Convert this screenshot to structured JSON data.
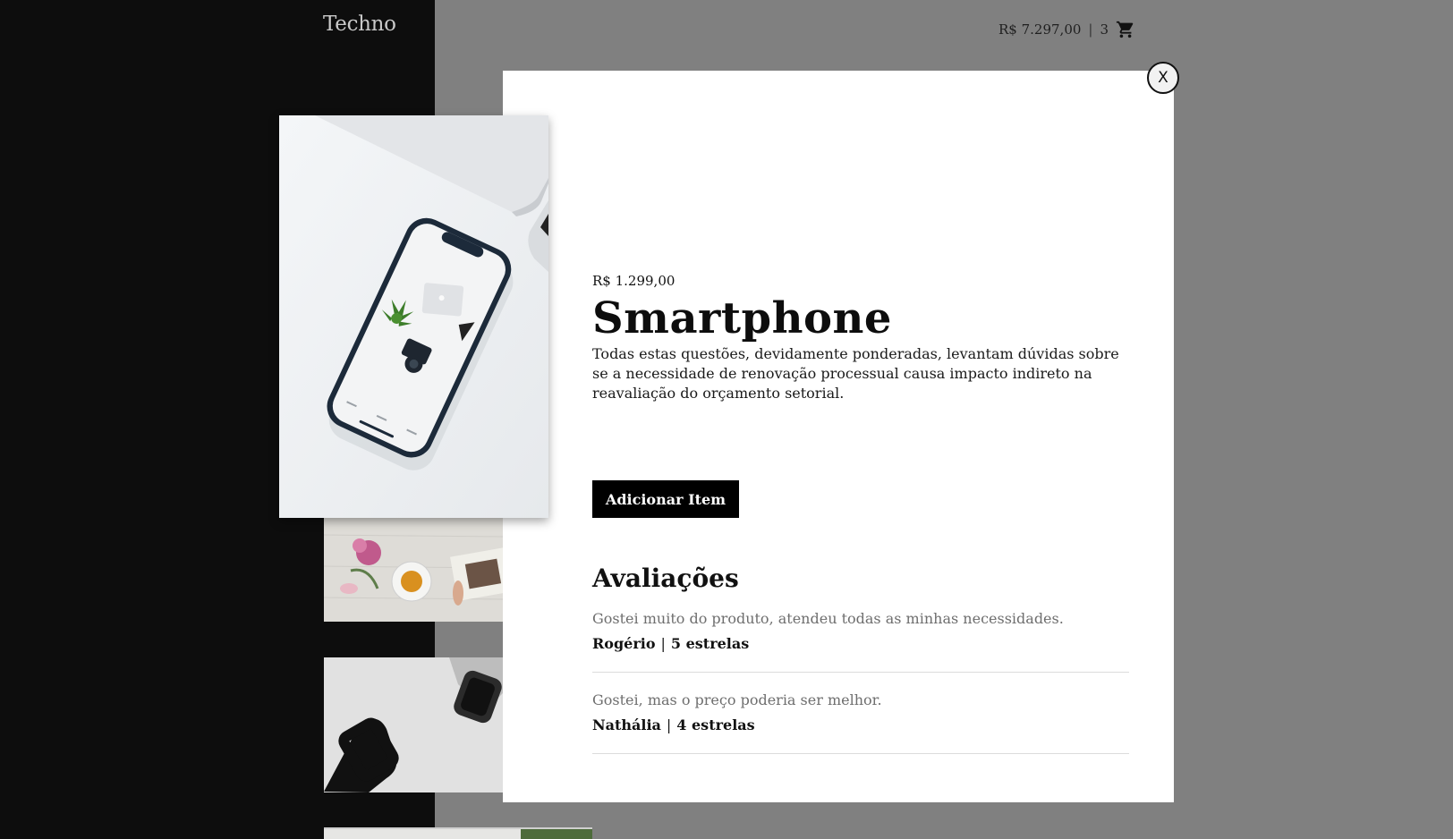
{
  "header": {
    "logo": "Techno",
    "cart_total": "R$ 7.297,00",
    "cart_separator": "|",
    "cart_count": "3",
    "cart_icon": "shopping-cart-icon"
  },
  "modal": {
    "close_label": "X",
    "product": {
      "price": "R$ 1.299,00",
      "name": "Smartphone",
      "description": "Todas estas questões, devidamente ponderadas, levantam dúvidas sobre se a necessidade de renovação processual causa impacto indireto na reavaliação do orçamento setorial.",
      "add_button_label": "Adicionar Item"
    },
    "reviews": {
      "title": "Avaliações",
      "items": [
        {
          "text": "Gostei muito do produto, atendeu todas as minhas necessidades.",
          "author": "Rogério",
          "rating": "5 estrelas"
        },
        {
          "text": "Gostei, mas o preço poderia ser melhor.",
          "author": "Nathália",
          "rating": "4 estrelas"
        }
      ],
      "separator": "|"
    }
  }
}
